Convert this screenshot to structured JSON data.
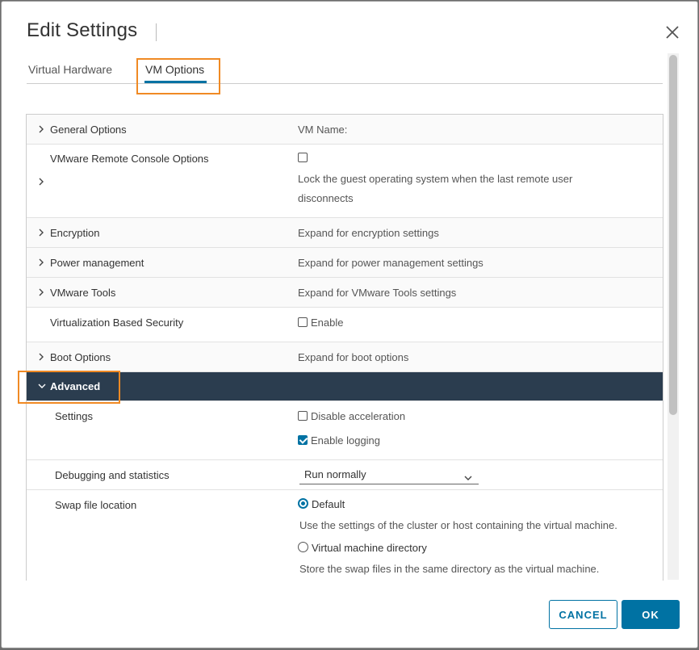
{
  "dialog": {
    "title": "Edit Settings",
    "close_icon": "close-icon"
  },
  "tabs": [
    {
      "label": "Virtual Hardware",
      "active": false
    },
    {
      "label": "VM Options",
      "active": true
    }
  ],
  "rows": {
    "general": {
      "label": "General Options",
      "value": "VM Name:"
    },
    "vmrc": {
      "label": "VMware Remote Console Options",
      "checked": false,
      "description": "Lock the guest operating system when the last remote user",
      "description2": "disconnects"
    },
    "encryption": {
      "label": "Encryption",
      "value": "Expand for encryption settings"
    },
    "power": {
      "label": "Power management",
      "value": "Expand for power management settings"
    },
    "tools": {
      "label": "VMware Tools",
      "value": "Expand for VMware Tools settings"
    },
    "vbs": {
      "label": "Virtualization Based Security",
      "checkbox_label": "Enable",
      "checked": false
    },
    "boot": {
      "label": "Boot Options",
      "value": "Expand for boot options"
    },
    "advanced": {
      "label": "Advanced",
      "expanded": true
    },
    "settings": {
      "label": "Settings",
      "disable_accel": {
        "label": "Disable acceleration",
        "checked": false
      },
      "enable_logging": {
        "label": "Enable logging",
        "checked": true
      }
    },
    "debugging": {
      "label": "Debugging and statistics",
      "selected": "Run normally"
    },
    "swap": {
      "label": "Swap file location",
      "default": {
        "label": "Default",
        "selected": true,
        "description": "Use the settings of the cluster or host containing the virtual machine."
      },
      "vmdir": {
        "label": "Virtual machine directory",
        "selected": false,
        "description": "Store the swap files in the same directory as the virtual machine."
      }
    }
  },
  "footer": {
    "cancel_label": "CANCEL",
    "ok_label": "OK"
  },
  "colors": {
    "accent": "#0072a3",
    "highlight": "#f08a24",
    "advanced_header_bg": "#2b3d4f"
  }
}
